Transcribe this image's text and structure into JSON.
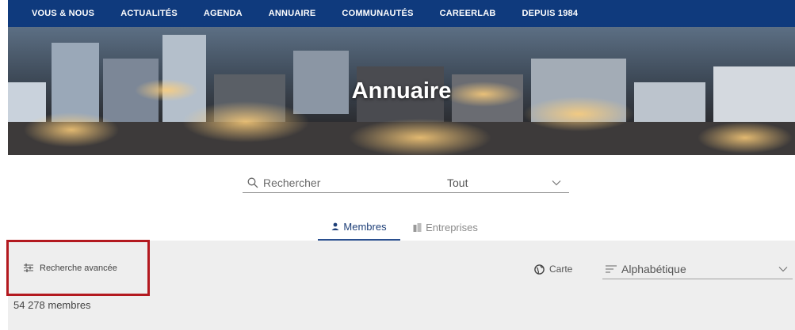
{
  "nav": {
    "items": [
      {
        "label": "VOUS & NOUS"
      },
      {
        "label": "ACTUALITÉS"
      },
      {
        "label": "AGENDA"
      },
      {
        "label": "ANNUAIRE"
      },
      {
        "label": "COMMUNAUTÉS"
      },
      {
        "label": "CAREERLAB"
      },
      {
        "label": "DEPUIS 1984"
      }
    ]
  },
  "hero": {
    "title": "Annuaire"
  },
  "search": {
    "placeholder": "Rechercher",
    "icon": "search-icon"
  },
  "filter": {
    "selected": "Tout",
    "icon": "chevron-down-icon"
  },
  "tabs": [
    {
      "label": "Membres",
      "icon": "person-icon",
      "active": true
    },
    {
      "label": "Entreprises",
      "icon": "building-icon",
      "active": false
    }
  ],
  "toolbar": {
    "advanced_search_label": "Recherche avancée",
    "advanced_search_icon": "sliders-icon",
    "map_label": "Carte",
    "map_icon": "globe-icon",
    "sort_selected": "Alphabétique",
    "sort_icon": "sort-icon"
  },
  "results": {
    "count_label": "54 278 membres"
  },
  "colors": {
    "nav_bg": "#0f3a7d",
    "highlight_border": "#b3191f",
    "active_tab": "#1e3f78",
    "panel_bg": "#eeeeee"
  }
}
